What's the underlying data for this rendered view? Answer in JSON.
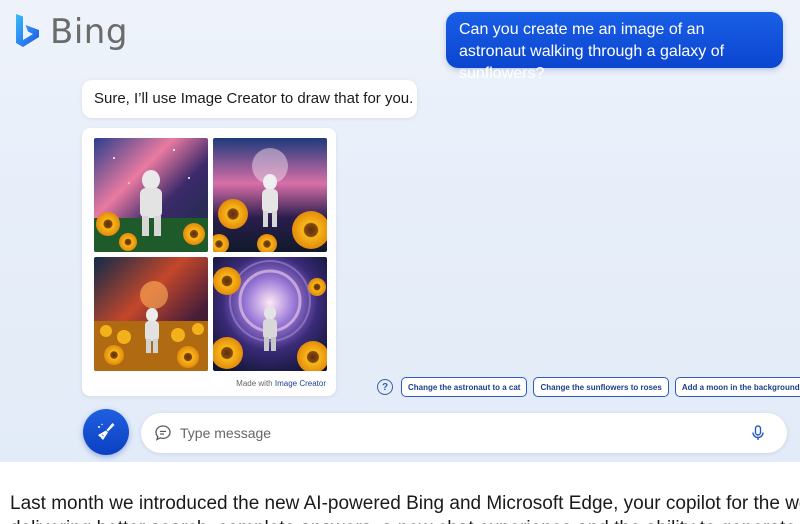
{
  "header": {
    "logo_text": "Bing",
    "logo_icon": "bing-logo-icon"
  },
  "conversation": {
    "user_message": "Can you create me an image of an astronaut walking through a galaxy of sunflowers?",
    "bot_message": "Sure, I’ll use Image Creator to draw that for you.",
    "image_card": {
      "image_count": 4,
      "made_with_prefix": "Made with",
      "made_with_link": "Image Creator"
    }
  },
  "suggestions": {
    "help_icon": "question-icon",
    "items": [
      "Change the astronaut to a cat",
      "Change the sunflowers to roses",
      "Add a moon in the background"
    ]
  },
  "input": {
    "placeholder": "Type message",
    "new_topic_icon": "broom-icon",
    "chat_icon": "chat-bubble-icon",
    "mic_icon": "microphone-icon"
  },
  "caption": {
    "text": "Last month we introduced the new AI-powered Bing and Microsoft Edge, your copilot for the web –",
    "text_line2": "delivering better search, complete answers, a new chat experience and the ability to generate..."
  },
  "colors": {
    "accent": "#1a5fe6",
    "chip_border": "#2c5cc0",
    "background_top": "#eef3fb"
  }
}
